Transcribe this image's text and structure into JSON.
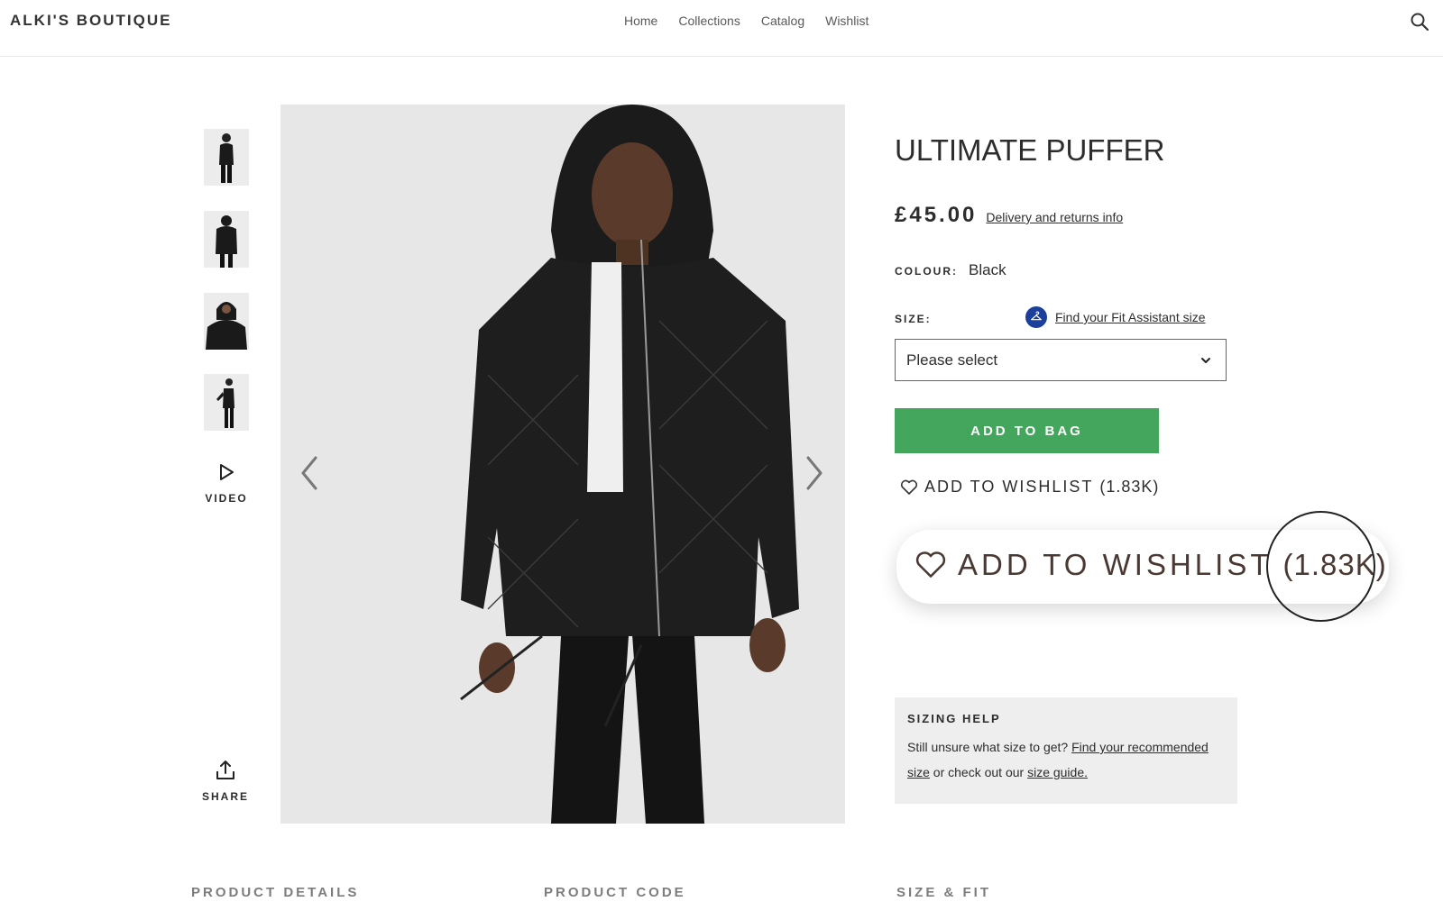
{
  "header": {
    "brand": "ALKI'S BOUTIQUE",
    "nav": [
      "Home",
      "Collections",
      "Catalog",
      "Wishlist"
    ],
    "search_icon": "search-icon"
  },
  "gallery": {
    "video_label": "VIDEO",
    "share_label": "SHARE",
    "thumbnail_count": 4
  },
  "product": {
    "title": "ULTIMATE PUFFER",
    "price": "£45.00",
    "delivery_link": "Delivery and returns info",
    "colour_label": "COLOUR:",
    "colour_value": "Black",
    "size_label": "SIZE:",
    "fit_assistant_link": "Find your Fit Assistant size",
    "size_placeholder": "Please select",
    "add_to_bag": "ADD TO BAG",
    "wishlist_label": "ADD TO WISHLIST",
    "wishlist_count": "(1.83K)"
  },
  "callout": {
    "wishlist_label": "ADD TO WISHLIST",
    "wishlist_count": "(1.83K)"
  },
  "sizing_help": {
    "title": "SIZING HELP",
    "text_before": "Still unsure what size to get? ",
    "link_recommended": "Find your recommended size",
    "text_middle": " or check out our ",
    "link_guide": "size guide."
  },
  "bottom_sections": [
    "PRODUCT DETAILS",
    "PRODUCT CODE",
    "SIZE & FIT"
  ],
  "colors": {
    "add_to_bag_green": "#44a55d",
    "fit_assistant_blue": "#1b3f9a",
    "sizing_help_bg": "#eeeeee"
  }
}
